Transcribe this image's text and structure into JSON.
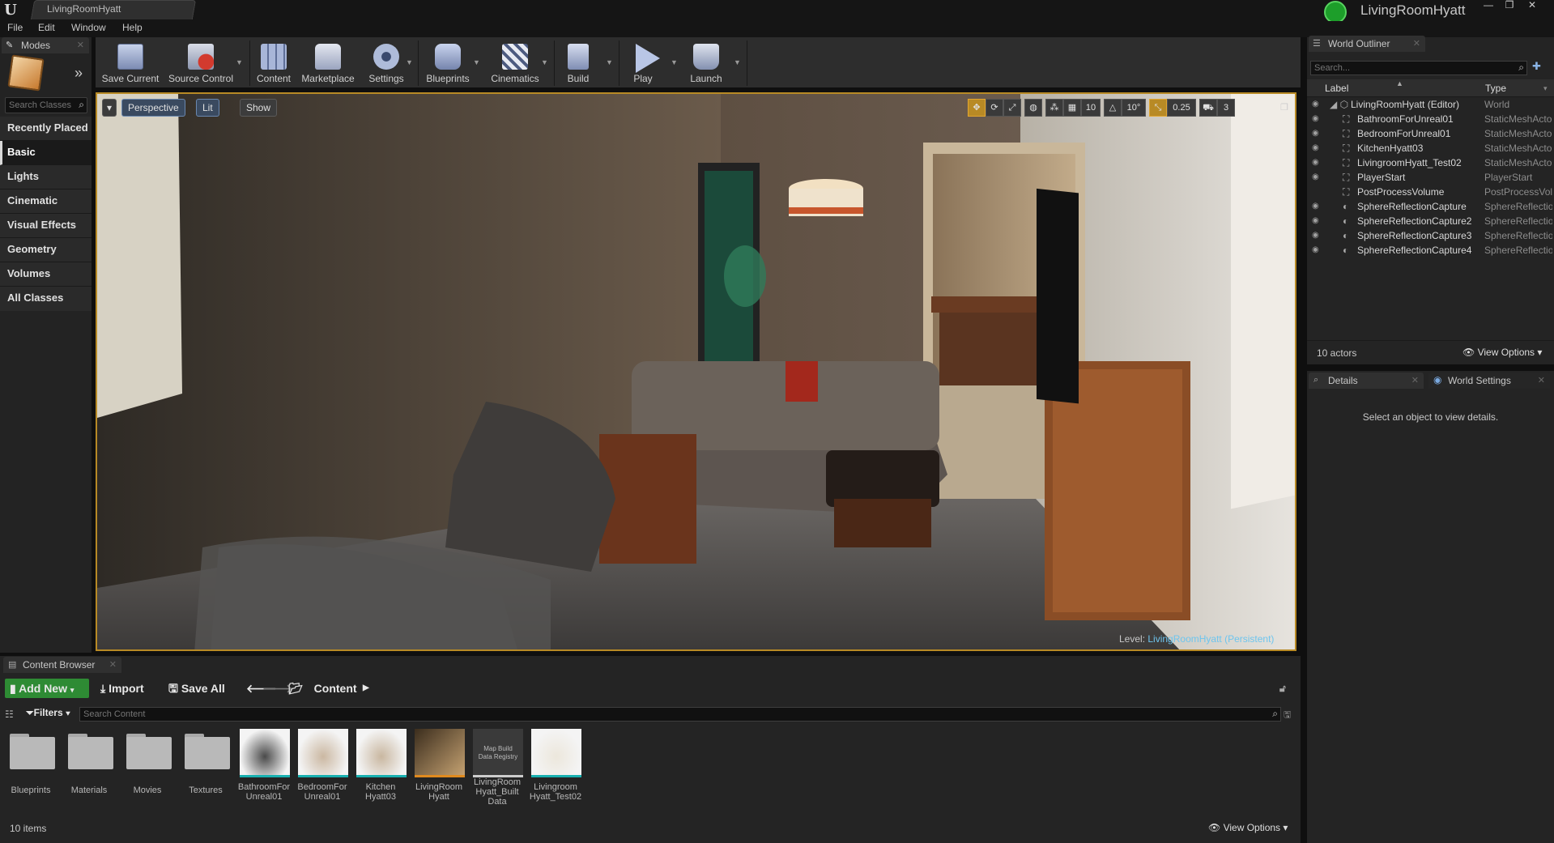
{
  "window": {
    "logo": "U",
    "tab": "LivingRoomHyatt",
    "project": "LivingRoomHyatt",
    "minimize": "—",
    "maximize": "❐",
    "close": "✕"
  },
  "menu": [
    "File",
    "Edit",
    "Window",
    "Help"
  ],
  "modes": {
    "tab": "Modes",
    "search_placeholder": "Search Classes",
    "categories": [
      "Recently Placed",
      "Basic",
      "Lights",
      "Cinematic",
      "Visual Effects",
      "Geometry",
      "Volumes",
      "All Classes"
    ],
    "selected": "Basic"
  },
  "toolbar": {
    "buttons": [
      {
        "label": "Save Current",
        "icon": "save-icon"
      },
      {
        "label": "Source Control",
        "icon": "source-control-icon"
      },
      {
        "label": "Content",
        "icon": "content-icon"
      },
      {
        "label": "Marketplace",
        "icon": "marketplace-icon"
      },
      {
        "label": "Settings",
        "icon": "settings-icon"
      },
      {
        "label": "Blueprints",
        "icon": "blueprints-icon"
      },
      {
        "label": "Cinematics",
        "icon": "cinematics-icon"
      },
      {
        "label": "Build",
        "icon": "build-icon"
      },
      {
        "label": "Play",
        "icon": "play-icon"
      },
      {
        "label": "Launch",
        "icon": "launch-icon"
      }
    ]
  },
  "viewport": {
    "perspective": "Perspective",
    "lit": "Lit",
    "show": "Show",
    "grid_snap": "10",
    "rotation_snap": "10°",
    "scale_snap": "0.25",
    "camera_speed": "3",
    "level_label": "Level:",
    "level_name": "LivingRoomHyatt (Persistent)"
  },
  "outliner": {
    "tab": "World Outliner",
    "search_placeholder": "Search...",
    "col_label": "Label",
    "col_type": "Type",
    "rows": [
      {
        "label": "LivingRoomHyatt (Editor)",
        "type": "World"
      },
      {
        "label": "BathroomForUnreal01",
        "type": "StaticMeshActor"
      },
      {
        "label": "BedroomForUnreal01",
        "type": "StaticMeshActor"
      },
      {
        "label": "KitchenHyatt03",
        "type": "StaticMeshActor"
      },
      {
        "label": "LivingroomHyatt_Test02",
        "type": "StaticMeshActor"
      },
      {
        "label": "PlayerStart",
        "type": "PlayerStart"
      },
      {
        "label": "PostProcessVolume",
        "type": "PostProcessVolume"
      },
      {
        "label": "SphereReflectionCapture",
        "type": "SphereReflectionCapture"
      },
      {
        "label": "SphereReflectionCapture2",
        "type": "SphereReflectionCapture"
      },
      {
        "label": "SphereReflectionCapture3",
        "type": "SphereReflectionCapture"
      },
      {
        "label": "SphereReflectionCapture4",
        "type": "SphereReflectionCapture"
      }
    ],
    "actor_count": "10 actors",
    "view_options": "View Options"
  },
  "details": {
    "tab": "Details",
    "tab2": "World Settings",
    "empty": "Select an object to view details."
  },
  "content_browser": {
    "tab": "Content Browser",
    "add_new": "Add New",
    "import": "Import",
    "save_all": "Save All",
    "path": "Content",
    "filters": "Filters",
    "search_placeholder": "Search Content",
    "assets": [
      {
        "label": "Blueprints",
        "kind": "folder"
      },
      {
        "label": "Materials",
        "kind": "folder"
      },
      {
        "label": "Movies",
        "kind": "folder"
      },
      {
        "label": "Textures",
        "kind": "folder"
      },
      {
        "label": "BathroomFor Unreal01",
        "kind": "mesh"
      },
      {
        "label": "BedroomFor Unreal01",
        "kind": "mesh"
      },
      {
        "label": "Kitchen Hyatt03",
        "kind": "mesh"
      },
      {
        "label": "LivingRoom Hyatt",
        "kind": "level"
      },
      {
        "label": "LivingRoom Hyatt_Built Data",
        "kind": "registry",
        "thumb_text": "Map Build Data Registry"
      },
      {
        "label": "Livingroom Hyatt_Test02",
        "kind": "mesh"
      }
    ],
    "item_count": "10 items",
    "view_options": "View Options"
  }
}
